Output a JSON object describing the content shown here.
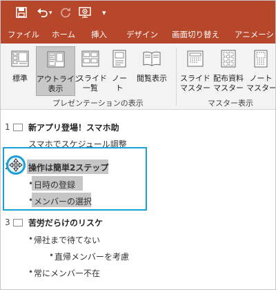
{
  "ribbon": {
    "tabs": [
      "ファイル",
      "ホーム",
      "挿入",
      "デザイン",
      "画面切り替え",
      "アニメーション"
    ],
    "presentation_views": {
      "group_label": "プレゼンテーションの表示",
      "buttons": [
        {
          "label": "標準",
          "icon": "normal-view-icon"
        },
        {
          "label": "アウトライン\n表示",
          "icon": "outline-view-icon",
          "active": true
        },
        {
          "label": "スライド\n一覧",
          "icon": "slide-sorter-icon"
        },
        {
          "label": "ノート",
          "icon": "notes-page-icon"
        },
        {
          "label": "閲覧表示",
          "icon": "reading-view-icon"
        }
      ]
    },
    "master_views": {
      "group_label": "マスター表示",
      "buttons": [
        {
          "label": "スライド\nマスター",
          "icon": "slide-master-icon"
        },
        {
          "label": "配布資料\nマスター",
          "icon": "handout-master-icon"
        },
        {
          "label": "ノート\nマスター",
          "icon": "notes-master-icon"
        }
      ]
    }
  },
  "outline": {
    "slides": [
      {
        "number": "1",
        "title": "新アプリ登場！スマホ助",
        "body": [
          "スマホでスケジュール調整"
        ]
      },
      {
        "number": "2",
        "title": "操作は簡単2ステップ",
        "body": [
          "日時の登録",
          "メンバーの選択"
        ]
      },
      {
        "number": "3",
        "title": "苦労だらけのリスケ",
        "body": [
          "帰社まで待てない",
          "直帰メンバーを考慮",
          "常にメンバー不在"
        ]
      }
    ]
  },
  "colors": {
    "accent": "#b7472a",
    "selection": "#1aa0d9",
    "highlight": "#c6c6c6"
  }
}
